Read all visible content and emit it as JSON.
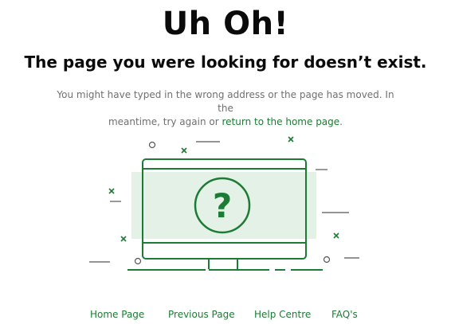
{
  "page": {
    "headline": "Uh Oh!",
    "subheadline": "The page you were looking for doesn’t exist.",
    "message": {
      "line1": "You might have typed in the wrong address or the page has moved. In the",
      "line2_prefix": "meantime, try again or ",
      "home_link": "return to the home page",
      "line2_suffix": "."
    }
  },
  "illustration": {
    "icon": "monitor-question-icon",
    "glyph": "?"
  },
  "footer": {
    "links": [
      {
        "label": "Home Page"
      },
      {
        "label": "Previous Page"
      },
      {
        "label": "Help Centre"
      },
      {
        "label": "FAQ's"
      }
    ]
  },
  "colors": {
    "accent": "#1c7b34",
    "accent_light": "#e3f1e6",
    "text_dark": "#0b0b0b",
    "text_muted": "#6f6f6f",
    "decor_gray": "#555555"
  }
}
